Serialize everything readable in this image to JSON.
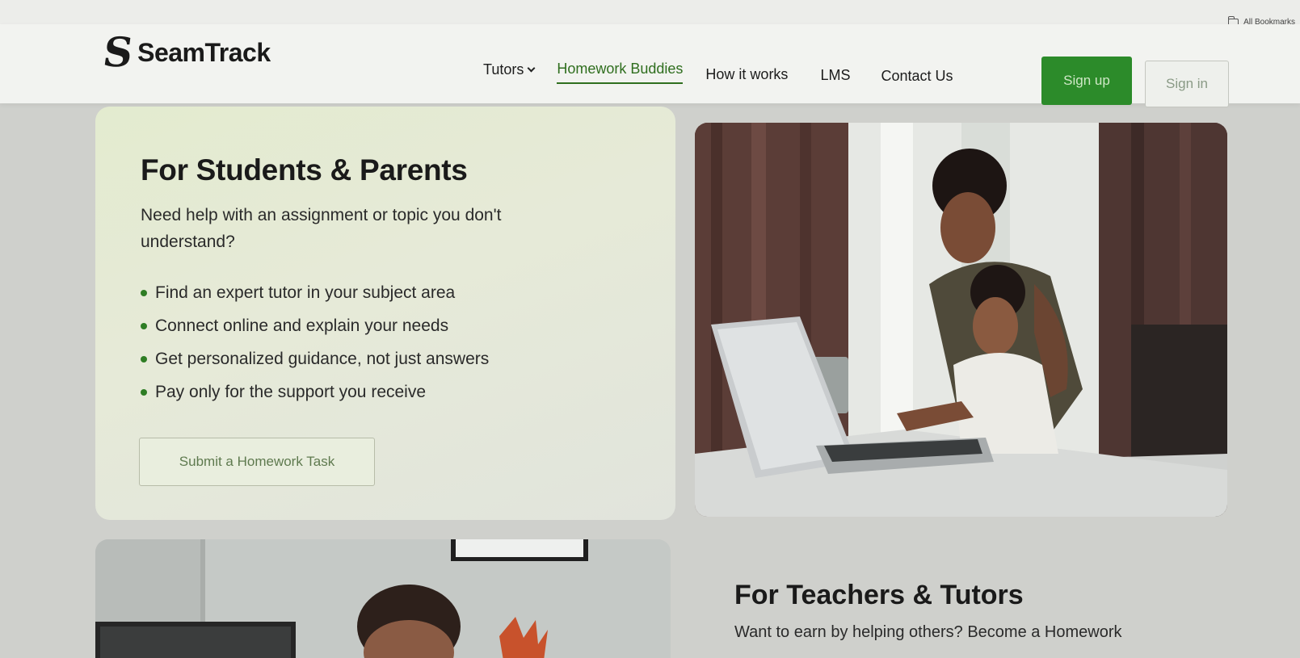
{
  "browser": {
    "bookmarks_label": "All Bookmarks"
  },
  "header": {
    "logo_mark": "S",
    "logo_text": "SeamTrack",
    "nav": {
      "tutors": "Tutors",
      "homework_buddies": "Homework Buddies",
      "how_it_works": "How it works",
      "lms": "LMS",
      "contact": "Contact Us"
    },
    "signup_label": "Sign up",
    "signin_label": "Sign in"
  },
  "students": {
    "title": "For Students & Parents",
    "description": "Need help with an assignment or topic you don't understand?",
    "bullets": [
      "Find an expert tutor in your subject area",
      "Connect online and explain your needs",
      "Get personalized guidance, not just answers",
      "Pay only for the support you receive"
    ],
    "cta_label": "Submit a Homework Task"
  },
  "teachers": {
    "title": "For Teachers & Tutors",
    "description": "Want to earn by helping others? Become a Homework"
  },
  "colors": {
    "brand_green": "#2c8b2a",
    "active_nav": "#2f6e1e",
    "card_bg": "#e3ebcf"
  }
}
